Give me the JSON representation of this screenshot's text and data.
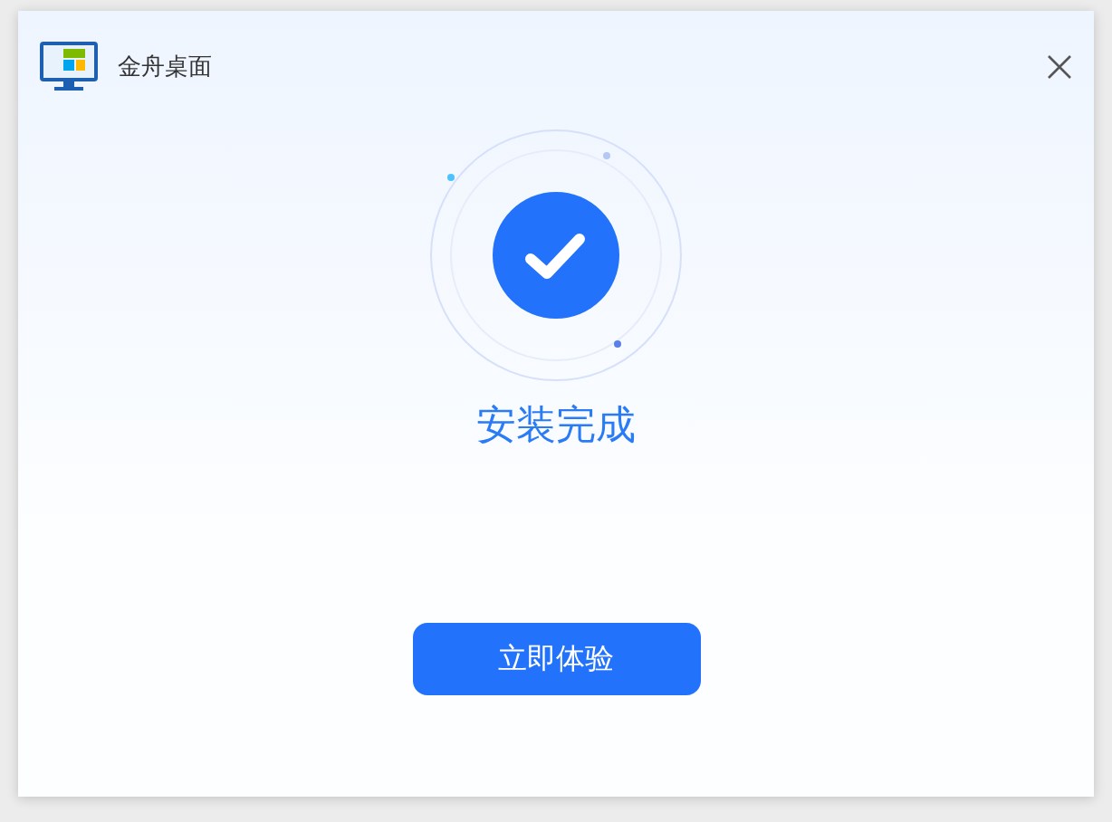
{
  "window": {
    "title": "金舟桌面"
  },
  "status": {
    "message": "安装完成"
  },
  "buttons": [
    {
      "label": "立即体验"
    }
  ]
}
